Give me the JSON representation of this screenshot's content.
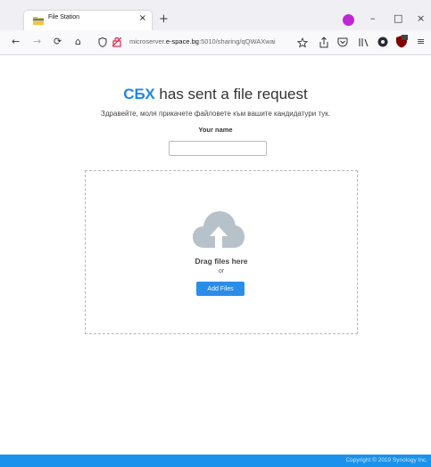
{
  "browser": {
    "tab_title": "File Station",
    "tab_close": "×",
    "new_tab": "+",
    "window_controls": {
      "minimize": "–",
      "maximize": "□",
      "close": "×"
    },
    "url": {
      "prefix": "microserver.",
      "host": "e-space.bg",
      "path": ":5010/sharing/qQWAXwai"
    },
    "nav_glyphs": {
      "back": "←",
      "forward": "→",
      "reload": "⟳",
      "home": "⌂"
    }
  },
  "page": {
    "title_org": "СБХ",
    "title_rest": " has sent a file request",
    "subtitle": "Здравейте, моля прикачете файловете към вашите кандидатури тук.",
    "name_label": "Your name",
    "name_value": "",
    "drag_text": "Drag files here",
    "or_text": "or",
    "add_files_label": "Add Files"
  },
  "footer": {
    "copyright": "Copyright © 2019 Synology Inc."
  },
  "colors": {
    "accent": "#1e88e5",
    "button": "#2a8de8",
    "footer": "#1a92ec",
    "cloud": "#b7c1ca"
  }
}
